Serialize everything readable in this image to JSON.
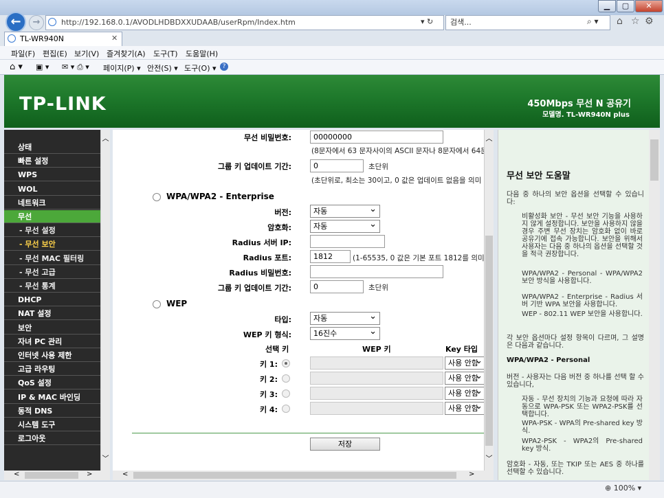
{
  "browser": {
    "url": "http://192.168.0.1/AVODLHDBDXXUDAAB/userRpm/Index.htm",
    "search_placeholder": "검색...",
    "tab_title": "TL-WR940N",
    "menu": [
      "파일(F)",
      "편집(E)",
      "보기(V)",
      "즐겨찾기(A)",
      "도구(T)",
      "도움말(H)"
    ],
    "cmd": [
      "페이지(P) ▾",
      "안전(S) ▾",
      "도구(O) ▾"
    ],
    "zoom": "100%"
  },
  "banner": {
    "logo": "TP-LINK",
    "product": "450Mbps 무선 N 공유기",
    "model": "모델명. TL-WR940N plus"
  },
  "left_menu": [
    {
      "label": "상태",
      "type": "main"
    },
    {
      "label": "빠른 설정",
      "type": "main"
    },
    {
      "label": "WPS",
      "type": "main"
    },
    {
      "label": "WOL",
      "type": "main"
    },
    {
      "label": "네트워크",
      "type": "main"
    },
    {
      "label": "무선",
      "type": "active"
    },
    {
      "label": "- 무선 설정",
      "type": "sub"
    },
    {
      "label": "- 무선 보안",
      "type": "subactive"
    },
    {
      "label": "- 무선 MAC 필터링",
      "type": "sub"
    },
    {
      "label": "- 무선 고급",
      "type": "sub"
    },
    {
      "label": "- 무선 통계",
      "type": "sub"
    },
    {
      "label": "DHCP",
      "type": "main"
    },
    {
      "label": "NAT 설정",
      "type": "main"
    },
    {
      "label": "보안",
      "type": "main"
    },
    {
      "label": "자녀 PC 관리",
      "type": "main"
    },
    {
      "label": "인터넷 사용 제한",
      "type": "main"
    },
    {
      "label": "고급 라우팅",
      "type": "main"
    },
    {
      "label": "QoS 설정",
      "type": "main"
    },
    {
      "label": "IP & MAC 바인딩",
      "type": "main"
    },
    {
      "label": "동적 DNS",
      "type": "main"
    },
    {
      "label": "시스템 도구",
      "type": "main"
    },
    {
      "label": "로그아웃",
      "type": "main"
    }
  ],
  "form": {
    "pw_label": "무선 비밀번호:",
    "pw_value": "00000000",
    "pw_note": "(8문자에서 63 문자사이의 ASCII 문자나 8문자에서 64문",
    "gk_label": "그룹 키 업데이트 기간:",
    "gk_value": "0",
    "gk_unit": "초단위",
    "gk_note": "(초단위로, 최소는 30이고, 0 값은 업데이트 없음을 의미",
    "ent_title": "WPA/WPA2 - Enterprise",
    "ver_label": "버전:",
    "ver_value": "자동",
    "enc_label": "암호화:",
    "enc_value": "자동",
    "rip_label": "Radius 서버 IP:",
    "rport_label": "Radius 포트:",
    "rport_value": "1812",
    "rport_note": "(1-65535, 0 값은 기본 포트 1812를 의미합",
    "rpw_label": "Radius 비밀번호:",
    "gk2_label": "그룹 키 업데이트 기간:",
    "gk2_value": "0",
    "gk2_unit": "초단위",
    "wep_title": "WEP",
    "type_label": "타입:",
    "type_value": "자동",
    "fmt_label": "WEP 키 형식:",
    "fmt_value": "16진수",
    "col_sel": "선택 키",
    "col_key": "WEP 키",
    "col_type": "Key 타입",
    "keys": [
      {
        "label": "키 1:",
        "type": "사용 안함"
      },
      {
        "label": "키 2:",
        "type": "사용 안함"
      },
      {
        "label": "키 3:",
        "type": "사용 안함"
      },
      {
        "label": "키 4:",
        "type": "사용 안함"
      }
    ],
    "save": "저장"
  },
  "help": {
    "title": "무선 보안 도움말",
    "intro": "다음 중 하나의 보안 옵션을 선택할 수 있습니다:",
    "b1": "비활성화 보안 - 무선 보안 기능을 사용하지 않게 설정합니다. 보안을 사용하지 않을 경우 주변 무선 장치는 암호화 없이 바로 공유기에 접속 가능합니다. 보안을 위해서 사용자는 다음 중 하나의 옵션을 선택할 것을 적극 권장합니다.",
    "b2": "WPA/WPA2 - Personal - WPA/WPA2 보안 방식을 사용합니다.",
    "b3": "WPA/WPA2 - Enterprise - Radius 서버 기반 WPA 보안을 사용합니다.",
    "b4": "WEP - 802.11 WEP 보안을 사용합니다.",
    "p2": "각 보안 옵션마다 설정 항목이 다르며, 그 설명은 다음과 같습니다.",
    "h2": "WPA/WPA2 - Personal",
    "p3": "버전 - 사용자는 다음 버전 중 하나를 선택 할 수 있습니다,",
    "c1": "자동 - 무선 장치의 기능과 요청에 따라 자동으로 WPA-PSK 또는 WPA2-PSK를 선택합니다.",
    "c2": "WPA-PSK - WPA의 Pre-shared key 방식.",
    "c3": "WPA2-PSK - WPA2의 Pre-shared key 방식.",
    "p4": "암호화 - 자동, 또는 TKIP 또는 AES 중 하나를 선택할 수 있습니다."
  }
}
